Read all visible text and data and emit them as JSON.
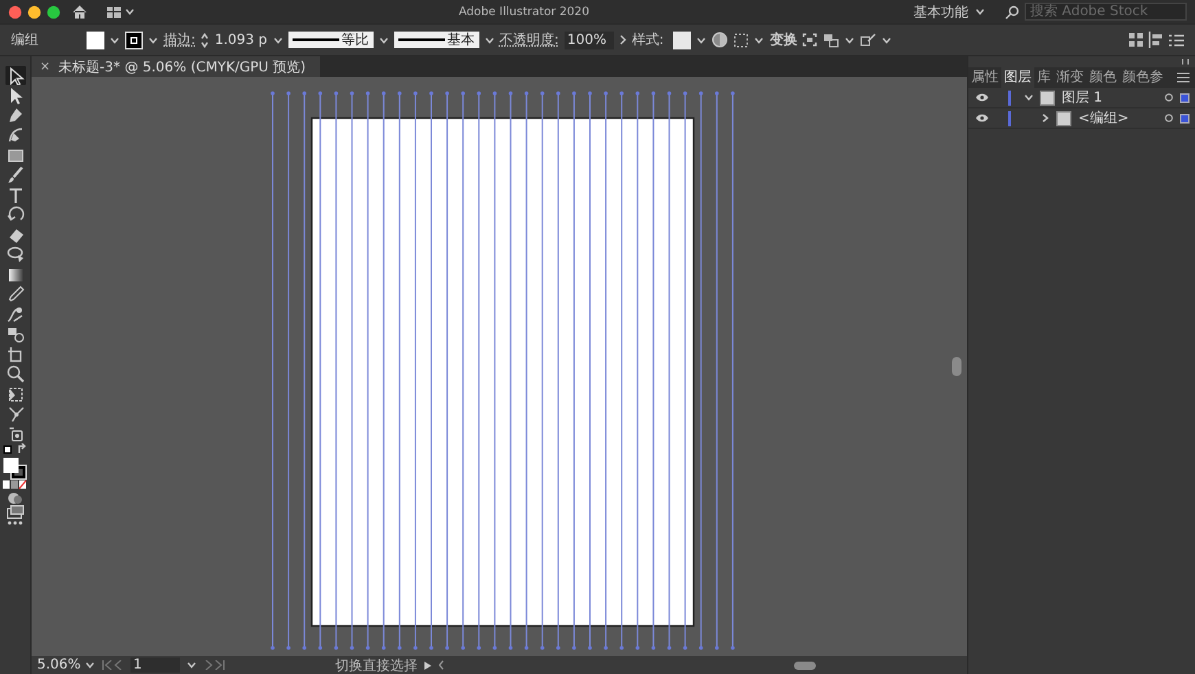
{
  "window": {
    "title": "Adobe Illustrator 2020",
    "workspace": "基本功能",
    "search": {
      "placeholder": "搜索 Adobe Stock"
    }
  },
  "control_bar": {
    "selection": "编组",
    "stroke_label": "描边:",
    "stroke_value": "1.093 p",
    "profile": "等比",
    "brush": "基本",
    "opacity_label": "不透明度:",
    "opacity": "100%",
    "style_label": "样式:",
    "transform": "变换"
  },
  "document_tab": {
    "close": "×",
    "title": "未标题-3* @ 5.06% (CMYK/GPU 预览)"
  },
  "tools": [
    {
      "kind": "select",
      "selected": true
    },
    {
      "kind": "direct",
      "selected": false
    },
    {
      "kind": "pen",
      "selected": false
    },
    {
      "kind": "curvature",
      "selected": false
    },
    {
      "kind": "rect",
      "selected": false
    },
    {
      "kind": "brush",
      "selected": false
    },
    {
      "kind": "type",
      "selected": false
    },
    {
      "kind": "rotate",
      "selected": false
    },
    {
      "kind": "eraser",
      "selected": false
    },
    {
      "kind": "lasso",
      "selected": false
    },
    {
      "kind": "gradient",
      "selected": false
    },
    {
      "kind": "eyedropper",
      "selected": false
    },
    {
      "kind": "blend",
      "selected": false
    },
    {
      "kind": "shapebuilder",
      "selected": false
    },
    {
      "kind": "artboard",
      "selected": false
    },
    {
      "kind": "zoom",
      "selected": false
    },
    {
      "kind": "freetransform",
      "selected": false
    },
    {
      "kind": "puppet",
      "selected": false
    },
    {
      "kind": "symbol",
      "selected": false
    }
  ],
  "panel": {
    "tabs": [
      {
        "label": "属性",
        "selected": false
      },
      {
        "label": "图层",
        "selected": true
      },
      {
        "label": "库",
        "selected": false
      },
      {
        "label": "渐变",
        "selected": false
      },
      {
        "label": "颜色",
        "selected": false
      },
      {
        "label": "颜色参",
        "selected": false
      }
    ],
    "layers": [
      {
        "name": "图层 1",
        "expanded": true,
        "children": [
          {
            "name": "<编组>",
            "expanded": false
          }
        ]
      }
    ]
  },
  "status_bar": {
    "zoom": "5.06%",
    "artboard": "1",
    "message": "切换直接选择"
  }
}
